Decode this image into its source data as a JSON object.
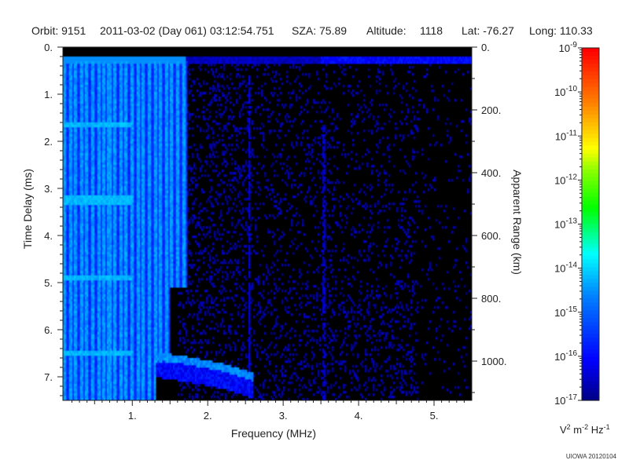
{
  "header": {
    "orbit": "Orbit: 9151",
    "datetime": "2011-03-02 (Day 061) 03:12:54.751",
    "sza": "SZA:  75.89",
    "altitude_label": "Altitude:",
    "altitude_value": "1118",
    "lat": "Lat: -76.27",
    "long": "Long: 110.33"
  },
  "footer": {
    "credit": "UIOWA 20120104"
  },
  "colors": {
    "plot_background": "#000000",
    "colorbar": [
      "#00007f",
      "#0000ff",
      "#0080ff",
      "#00ffff",
      "#00ff00",
      "#80ff00",
      "#ffff00",
      "#ff8000",
      "#ff0000"
    ]
  },
  "chart_data": {
    "type": "heatmap",
    "title": "",
    "xlabel": "Frequency (MHz)",
    "ylabel": "Time Delay (ms)",
    "y2label": "Apparent Range (km)",
    "xlim": [
      0.08,
      5.5
    ],
    "ylim": [
      0,
      7.5
    ],
    "y_inverted": true,
    "x_ticks": [
      {
        "value": 1,
        "label": "1."
      },
      {
        "value": 2,
        "label": "2."
      },
      {
        "value": 3,
        "label": "3."
      },
      {
        "value": 4,
        "label": "4."
      },
      {
        "value": 5,
        "label": "5."
      }
    ],
    "y_ticks": [
      {
        "value": 0,
        "label": "0."
      },
      {
        "value": 1,
        "label": "1."
      },
      {
        "value": 2,
        "label": "2."
      },
      {
        "value": 3,
        "label": "3."
      },
      {
        "value": 4,
        "label": "4."
      },
      {
        "value": 5,
        "label": "5."
      },
      {
        "value": 6,
        "label": "6."
      },
      {
        "value": 7,
        "label": "7."
      }
    ],
    "y2_ticks": [
      {
        "value": 0,
        "label": "0."
      },
      {
        "value": 200,
        "label": "200."
      },
      {
        "value": 400,
        "label": "400."
      },
      {
        "value": 600,
        "label": "600."
      },
      {
        "value": 800,
        "label": "800."
      },
      {
        "value": 1000,
        "label": "1000."
      }
    ],
    "y2_km_per_ms": 150,
    "colorbar": {
      "label_base": "V",
      "label_sup1": "2",
      "label_mid": " m",
      "label_sup2": "-2",
      "label_end": " Hz",
      "label_sup3": "-1",
      "scale": "log",
      "ticks": [
        {
          "exp": -9,
          "base": "10",
          "sup": "-9"
        },
        {
          "exp": -10,
          "base": "10",
          "sup": "-10"
        },
        {
          "exp": -11,
          "base": "10",
          "sup": "-11"
        },
        {
          "exp": -12,
          "base": "10",
          "sup": "-12"
        },
        {
          "exp": -13,
          "base": "10",
          "sup": "-13"
        },
        {
          "exp": -14,
          "base": "10",
          "sup": "-14"
        },
        {
          "exp": -15,
          "base": "10",
          "sup": "-15"
        },
        {
          "exp": -16,
          "base": "10",
          "sup": "-16"
        },
        {
          "exp": -17,
          "base": "10",
          "sup": "-17"
        }
      ],
      "range": [
        -17,
        -9
      ]
    },
    "features": [
      {
        "name": "low-frequency vertical striations",
        "freq_range": [
          0.08,
          1.7
        ],
        "delay_range": [
          0.2,
          7.5
        ],
        "level_exp": -14.5
      },
      {
        "name": "horizontal echo band",
        "freq_range": [
          0.08,
          5.5
        ],
        "delay_range": [
          0.2,
          0.35
        ],
        "level_exp": -15.5
      },
      {
        "name": "oblique echo trace",
        "points": [
          [
            1.3,
            6.55
          ],
          [
            1.7,
            6.65
          ],
          [
            2.2,
            6.8
          ],
          [
            2.6,
            7.0
          ]
        ],
        "level_exp": -14.8
      },
      {
        "name": "vertical line near 2.55 MHz",
        "freq": 2.55,
        "delay_range": [
          0.6,
          7.2
        ],
        "level_exp": -16.0
      },
      {
        "name": "vertical line near 3.55 MHz",
        "freq": 3.55,
        "delay_range": [
          1.6,
          7.5
        ],
        "level_exp": -16.2
      }
    ]
  }
}
